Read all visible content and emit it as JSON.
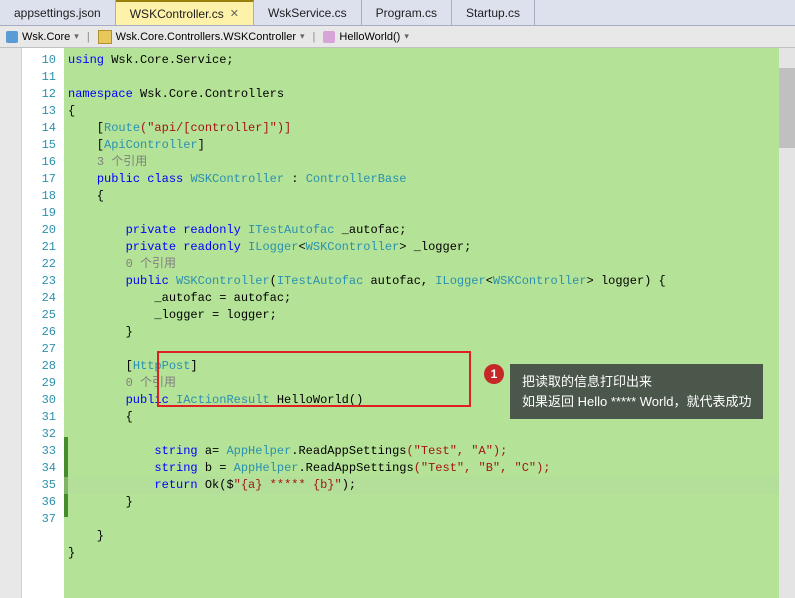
{
  "tabs": [
    {
      "label": "appsettings.json",
      "active": false
    },
    {
      "label": "WSKController.cs",
      "active": true
    },
    {
      "label": "WskService.cs",
      "active": false
    },
    {
      "label": "Program.cs",
      "active": false
    },
    {
      "label": "Startup.cs",
      "active": false
    }
  ],
  "breadcrumb": {
    "project": "Wsk.Core",
    "class": "Wsk.Core.Controllers.WSKController",
    "method": "HelloWorld()"
  },
  "lineNumbers": [
    "10",
    "11",
    "12",
    "13",
    "14",
    "15",
    "",
    "16",
    "17",
    "18",
    "19",
    "20",
    "",
    "21",
    "22",
    "23",
    "24",
    "25",
    "26",
    "",
    "27",
    "28",
    "29",
    "30",
    "31",
    "32",
    "33",
    "34",
    "35",
    "36",
    "37"
  ],
  "refs": {
    "ref3": "3 个引用",
    "ref0a": "0 个引用",
    "ref0b": "0 个引用"
  },
  "code": {
    "l10": {
      "kw": "using",
      "ns": " Wsk.Core.Service;"
    },
    "l12": {
      "kw": "namespace",
      "ns": " Wsk.Core.Controllers"
    },
    "l13": "{",
    "l14": {
      "open": "    [",
      "attr": "Route",
      "args": "(\"api/[controller]\")]"
    },
    "l15a": {
      "open": "    [",
      "attr": "ApiController",
      "close": "]"
    },
    "l16": {
      "indent": "    ",
      "kw1": "public",
      "kw2": " class ",
      "type1": "WSKController",
      "sep": " : ",
      "type2": "ControllerBase"
    },
    "l17": "    {",
    "l19": {
      "indent": "        ",
      "kw1": "private",
      "kw2": " readonly ",
      "type": "ITestAutofac",
      "rest": " _autofac;"
    },
    "l20": {
      "indent": "        ",
      "kw1": "private",
      "kw2": " readonly ",
      "type": "ILogger",
      "gen": "<",
      "type2": "WSKController",
      "rest": "> _logger;"
    },
    "l21": {
      "indent": "        ",
      "kw": "public ",
      "type1": "WSKController",
      "open": "(",
      "type2": "ITestAutofac",
      "p1": " autofac, ",
      "type3": "ILogger",
      "gen": "<",
      "type4": "WSKController",
      "p2": "> logger) {"
    },
    "l22": "            _autofac = autofac;",
    "l23": "            _logger = logger;",
    "l24": "        }",
    "l26": {
      "indent": "        [",
      "attr": "HttpPost",
      "close": "]"
    },
    "l27": {
      "indent": "        ",
      "kw": "public ",
      "type": "IActionResult",
      "method": " HelloWorld",
      "rest": "()"
    },
    "l28": "        {",
    "l30": {
      "indent": "            ",
      "kw": "string",
      "var": " a= ",
      "type": "AppHelper",
      "method": ".ReadAppSettings",
      "args": "(\"Test\", \"A\");"
    },
    "l31": {
      "indent": "            ",
      "kw": "string",
      "var": " b = ",
      "type": "AppHelper",
      "method": ".ReadAppSettings",
      "args": "(\"Test\", \"B\", \"C\");"
    },
    "l32": {
      "indent": "            ",
      "kw": "return",
      "method": " Ok",
      "open": "($",
      "str": "\"{a} ***** {b}\"",
      "close": ");"
    },
    "l33": "        }",
    "l35": "    }",
    "l36": "}"
  },
  "callout": {
    "num": "1",
    "line1": "把读取的信息打印出来",
    "line2": "如果返回 Hello ***** World，就代表成功"
  }
}
